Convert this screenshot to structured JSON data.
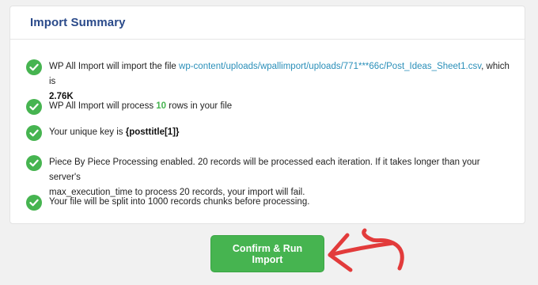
{
  "summary": {
    "title": "Import Summary",
    "items": [
      {
        "text_before": "WP All Import will import the file ",
        "file_link": "wp-content/uploads/wpallimport/uploads/771***66c/Post_Ideas_Sheet1.csv",
        "text_after": ", which is",
        "file_size": "2.76K"
      },
      {
        "text_before": "WP All Import will process ",
        "rows_count": "10",
        "text_after": " rows in your file"
      },
      {
        "text_before": "Your unique key is ",
        "unique_key": "{posttitle[1]}"
      },
      {
        "line1": "Piece By Piece Processing enabled. 20 records will be processed each iteration. If it takes longer than your server's",
        "line2": "max_execution_time to process 20 records, your import will fail."
      },
      {
        "text": "Your file will be split into 1000 records chunks before processing."
      }
    ]
  },
  "confirm_button": {
    "label": "Confirm & Run Import"
  },
  "colors": {
    "success": "#46b450",
    "title": "#2a4a8a",
    "link": "#2a8fb9",
    "annotation": "#e23b3b"
  },
  "icons": {
    "check": "check-circle-icon",
    "annotation": "annotation-arrow-icon"
  }
}
